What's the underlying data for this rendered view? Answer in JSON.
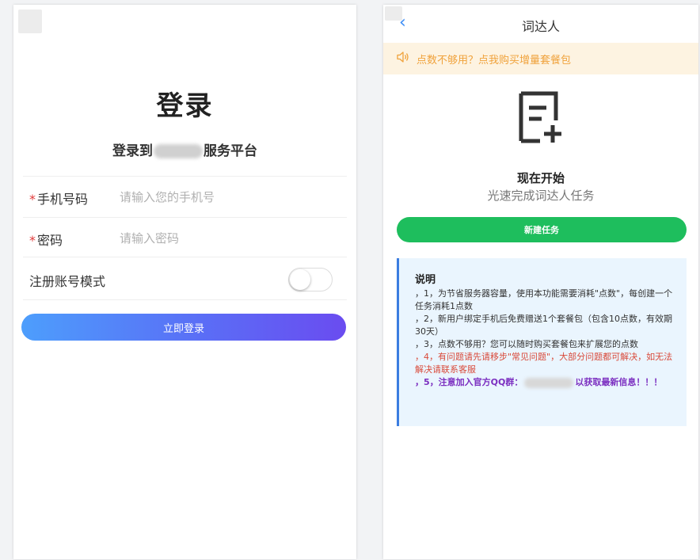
{
  "login": {
    "title": "登录",
    "subtitle_prefix": "登录到",
    "subtitle_suffix": "服务平台",
    "phone_label": "手机号码",
    "phone_placeholder": "请输入您的手机号",
    "password_label": "密码",
    "password_placeholder": "请输入密码",
    "register_label": "注册账号模式",
    "register_toggle_on": false,
    "submit_label": "立即登录"
  },
  "task": {
    "nav_title": "词达人",
    "notice": "点数不够用？点我购买增量套餐包",
    "start_title": "现在开始",
    "start_subtitle": "光速完成词达人任务",
    "new_task_label": "新建任务",
    "info_title": "说明",
    "info_items": [
      "，1，为节省服务器容量，使用本功能需要消耗\"点数\"，每创建一个任务消耗1点数",
      "，2，新用户绑定手机后免费赠送1个套餐包（包含10点数，有效期30天）",
      "，3，点数不够用？您可以随时购买套餐包来扩展您的点数",
      "，4，有问题请先请移步\"常见问题\"，大部分问题都可解决，如无法解决请联系客服",
      "，5，注意加入官方QQ群：",
      "以获取最新信息！！！"
    ]
  },
  "colors": {
    "login_gradient_start": "#4d9efc",
    "login_gradient_end": "#6a4cf0",
    "new_task_green": "#1ebe5d",
    "notice_orange": "#f0a23b",
    "info_bg": "#eaf5fe",
    "info_border": "#3b7de0",
    "info_red": "#d94a3a",
    "info_purple": "#7b2ec0"
  },
  "icons": {
    "back": "chevron-left-icon",
    "notice": "speaker-icon",
    "task": "new-task-icon"
  }
}
